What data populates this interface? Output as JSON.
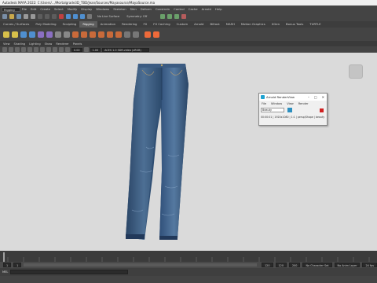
{
  "window": {
    "title": "Autodesk MAYA 2022: C:/Users/.../Mortalgrade3D_TBD/Jean/Sources/Mayasource/MayaSource.ma"
  },
  "menubar": {
    "workspace": "Rigging",
    "items": [
      "File",
      "Edit",
      "Create",
      "Select",
      "Modify",
      "Display",
      "Windows",
      "Skeleton",
      "Skin",
      "Deform",
      "Constrain",
      "Control",
      "Cache",
      "Arnold",
      "Help"
    ]
  },
  "statusline": {
    "symmetry": "No Live Surface",
    "symmetry2": "Symmetry: Off"
  },
  "shelf_tabs": [
    "Curves / Surfaces",
    "Poly Modeling",
    "Sculpting",
    "Rigging",
    "Animation",
    "Rendering",
    "FX",
    "FX Caching",
    "Custom",
    "Arnold",
    "Bifrost",
    "MASH",
    "Motion Graphics",
    "XGen",
    "Bonus Tools",
    "TURTLE"
  ],
  "active_shelf_tab": "Rigging",
  "panel_menu": [
    "View",
    "Shading",
    "Lighting",
    "Show",
    "Renderer",
    "Panels"
  ],
  "panel_toolbar": {
    "exposure": "0.00",
    "gamma": "1.00",
    "colorspace": "ACES 1.0 SDR-video (sRGB)"
  },
  "viewport": {
    "bg": "#dadada",
    "subject": "denim-jeans"
  },
  "arnold_popup": {
    "title": "Arnold RenderView",
    "menu": [
      "File",
      "Window",
      "View",
      "Render"
    ],
    "dropdown": "Beauty",
    "status": "00:00:01 | 1920x1080 | 1:1 | persp/Shape | beauty"
  },
  "range": {
    "start": "1",
    "playback_start": "1",
    "end": "120",
    "playback_end": "120",
    "max": "200",
    "character_set": "No Character Set",
    "anim_layer": "No Anim Layer",
    "fps": "24 fps"
  },
  "commandline": {
    "label": "MEL"
  }
}
